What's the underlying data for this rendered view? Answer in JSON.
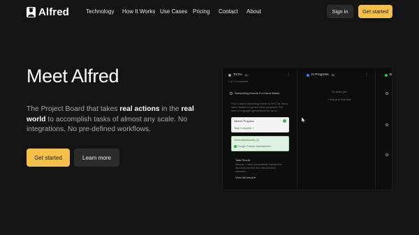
{
  "nav": {
    "brand": "Alfred",
    "links": [
      "Technology",
      "How It Works",
      "Use Cases",
      "Pricing",
      "Contact",
      "About"
    ],
    "sign_in": "Sign in",
    "get_started": "Get started"
  },
  "hero": {
    "title": "Meet Alfred",
    "sub_1": "The Project Board that takes ",
    "sub_b1": "real actions",
    "sub_2": " in the ",
    "sub_b2": "real world",
    "sub_3": " to accomplish tasks of almost any scale. No integrations. No pre-defined workflows.",
    "get_started": "Get started",
    "learn_more": "Learn more"
  },
  "board": {
    "col_todo": {
      "title": "To Do",
      "count": "1",
      "sub": "1 of 1 completed"
    },
    "task_title": "Networking-Events-For-Harm Wants",
    "task_desc_1": "Find 4 tasks networking events in NYC for Harry",
    "task_desc_2": "sales leaders to go and meet prospects. Put",
    "task_desc_3": "them in a google spreadsheet for us to...",
    "progress_title": "Alfred's Progress",
    "progress_sub": "Task Complete ✓",
    "assets_title": "Generated Assets (1)",
    "assets_item": "Google Sheets Spreadsheet",
    "result_title": "Task Result",
    "result_line1": "Marcus, I have successfully researched",
    "result_line2": "and documented five relevant tech",
    "result_line3": "networks...",
    "result_link": "View full result ▾",
    "col_progress": {
      "title": "In Progress",
      "count": "0",
      "empty": "No tasks yet",
      "add": "+ Add your first task"
    },
    "col_done": {
      "title": "Do"
    }
  },
  "colors": {
    "accent": "#f5c04a",
    "bg": "#141414",
    "progress_dot": "#3b82f6",
    "todo_dot": "#9ca3af"
  }
}
